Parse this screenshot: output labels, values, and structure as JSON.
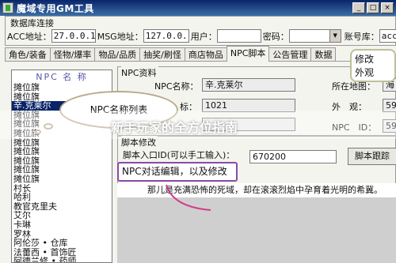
{
  "window": {
    "title": "魔域专用GM工具"
  },
  "db": {
    "legend": "数据库连接",
    "acc_label": "ACC地址：",
    "acc_value": "27.0.0.1",
    "msg_label": "MSG地址：",
    "msg_value": "127.0.0.1",
    "user_label": "用户：",
    "user_value": "",
    "pwd_label": "密码：",
    "pwd_value": "",
    "acct_label": "账号库：",
    "acct_value": "accou"
  },
  "tabs": [
    "角色/装备",
    "怪物/爆率",
    "物品/品质",
    "抽奖/刷怪",
    "商店物品",
    "NPC脚本",
    "公告管理",
    "数据"
  ],
  "active_tab": "NPC脚本",
  "npc_list": {
    "header": "NPC 名 称",
    "items": [
      "摊位旗",
      "摊位旗",
      "辛.克莱尔",
      "摊位旗",
      "摊位旗",
      "摊位旗",
      "摊位旗",
      "摊位旗",
      "摊位旗",
      "摊位旗",
      "摊位旗",
      "村长",
      "哈利",
      "教官克里夫",
      "艾尔",
      "卡琳",
      "罗林",
      "阿伦莎 • 仓库",
      "法蕾西 • 首饰匠",
      "阿德兰修 • 药师"
    ],
    "selected": "辛.克莱尔"
  },
  "npc_data": {
    "legend": "NPC资料",
    "name_label": "NPC名称：",
    "name_value": "辛.克莱尔",
    "map_label": "所在地图：",
    "map_value": "海",
    "mark_label": "标：",
    "mark_value": "1021",
    "look_label": "外　观：",
    "look_value": "59",
    "id_label": "NPC　ID：",
    "id_value": "59"
  },
  "script": {
    "legend": "脚本修改",
    "entry_label": "脚本入口ID(可以手工输入)：",
    "entry_value": "670200",
    "track_button": "脚本跟踪",
    "text": "那儿是充满恐怖的死域，却在滚滚烈焰中孕育着光明的希冀。"
  },
  "annotations": {
    "top_right": [
      "修改",
      "外观"
    ],
    "cloud": "NPC名称列表",
    "purple": "NPC对话编辑，以及修改"
  },
  "watermark": "新手玩家的全方位指南"
}
